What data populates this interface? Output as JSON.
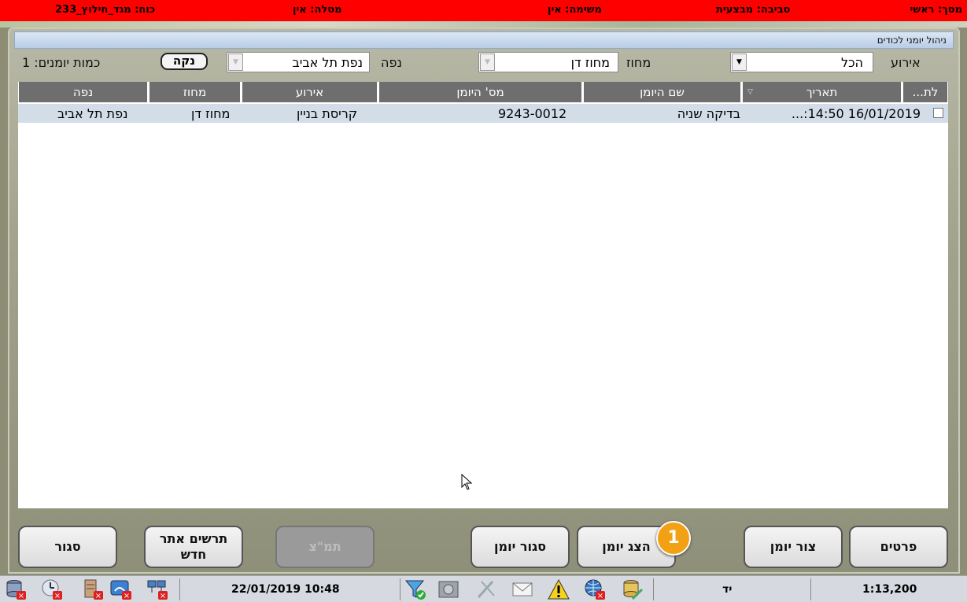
{
  "topbar": {
    "screen": "מסך: ראשי",
    "environment": "סביבה: מבצעית",
    "task": "משימה: אין",
    "mission": "מטלה: אין",
    "force": "כוח: מגד_חילוץ_233"
  },
  "window": {
    "title": "ניהול יומני לכודים"
  },
  "filters": {
    "event_label": "אירוע",
    "event_value": "הכל",
    "district_label": "מחוז",
    "district_value": "מחוז דן",
    "area_label": "נפה",
    "area_value": "נפת תל אביב",
    "clear_button": "נקה",
    "count_label": "כמות יומנים: 1"
  },
  "grid": {
    "columns": [
      "לת...",
      "תאריך",
      "שם היומן",
      "מס' היומן",
      "אירוע",
      "מחוז",
      "נפה"
    ],
    "rows": [
      {
        "date": "16/01/2019 14:50:...",
        "name": "בדיקה שניה",
        "number": "9243-0012",
        "event": "קריסת בניין",
        "district": "מחוז דן",
        "area": "נפת תל אביב"
      }
    ]
  },
  "buttons": {
    "details": "פרטים",
    "create": "צור יומן",
    "show": "הצג יומן",
    "close_log": "סגור יומן",
    "tmz": "תמ\"צ",
    "new_site_line1": "תרשים אתר",
    "new_site_line2": "חדש",
    "close": "סגור"
  },
  "badge": "1",
  "status": {
    "datetime": "22/01/2019 10:48",
    "mode": "יד",
    "scale": "1:13,200"
  },
  "colors": {
    "topbar": "#ff0000",
    "header": "#6e6e6e",
    "selected_row": "#d3dde8",
    "badge": "#f2a114"
  }
}
